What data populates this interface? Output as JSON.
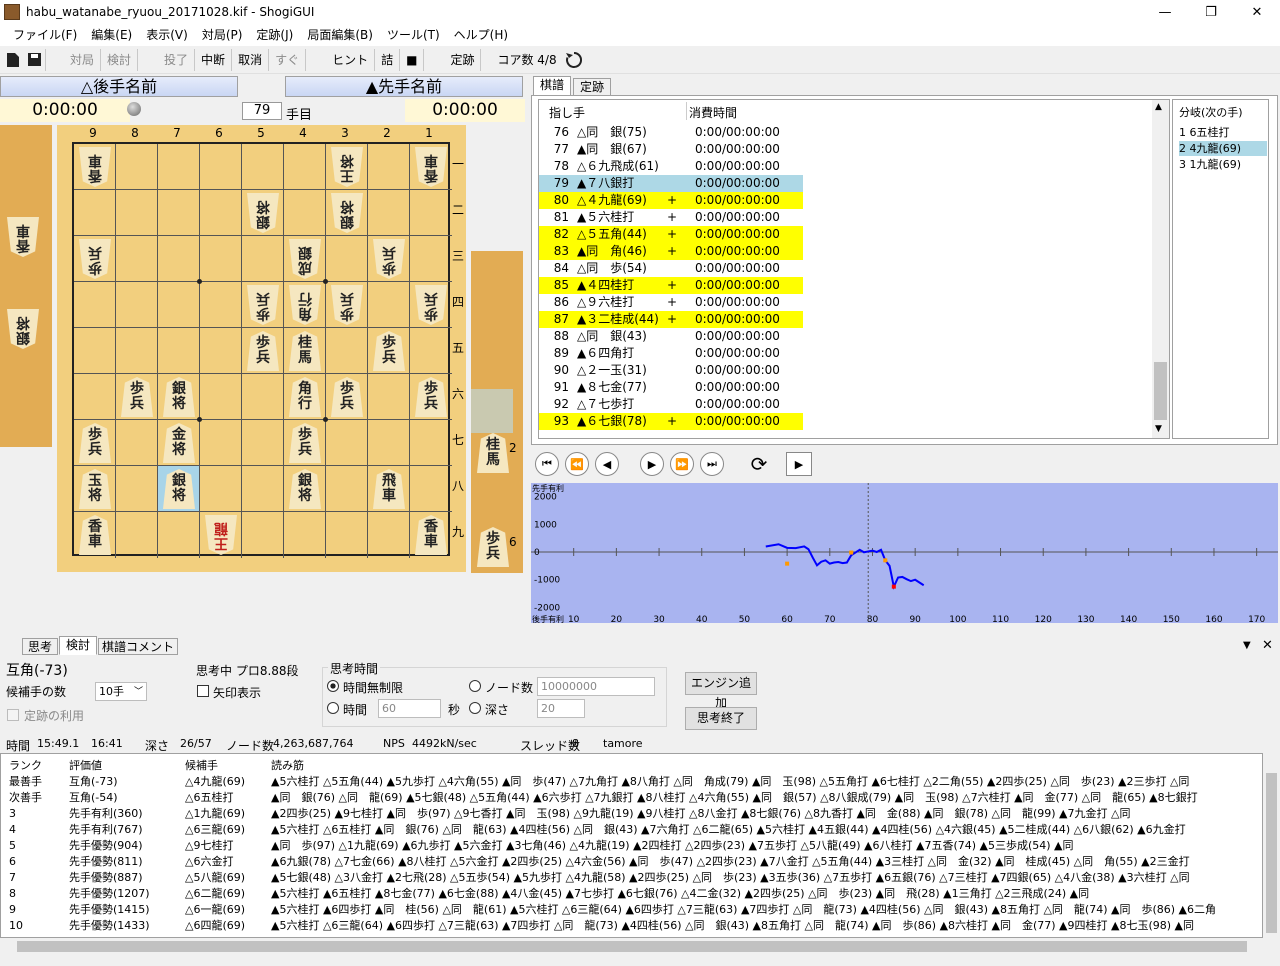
{
  "window": {
    "title": "habu_watanabe_ryuou_20171028.kif - ShogiGUI",
    "min": "—",
    "max": "❐",
    "close": "✕"
  },
  "menu": [
    "ファイル(F)",
    "編集(E)",
    "表示(V)",
    "対局(P)",
    "定跡(J)",
    "局面編集(B)",
    "ツール(T)",
    "ヘルプ(H)"
  ],
  "toolbar": {
    "items": [
      "対局",
      "検討",
      "投了",
      "中断",
      "取消",
      "すぐ",
      "ヒント",
      "詰",
      "■",
      "定跡",
      "コア数  4/8"
    ],
    "disabled": [
      true,
      true,
      true,
      false,
      false,
      true,
      false,
      false,
      false,
      false,
      false
    ]
  },
  "players": {
    "gote": "△後手名前",
    "sente": "▲先手名前"
  },
  "clocks": {
    "gote": "0:00:00",
    "sente": "0:00:00"
  },
  "move_counter": {
    "value": "79",
    "suffix": "手目"
  },
  "board": {
    "col_labels": [
      "9",
      "8",
      "7",
      "6",
      "5",
      "4",
      "3",
      "2",
      "1"
    ],
    "row_labels": [
      "一",
      "二",
      "三",
      "四",
      "五",
      "六",
      "七",
      "八",
      "九"
    ],
    "pieces": [
      {
        "r": 0,
        "c": 0,
        "t": "香\n車",
        "gote": true
      },
      {
        "r": 0,
        "c": 6,
        "t": "王\n将",
        "gote": true
      },
      {
        "r": 0,
        "c": 8,
        "t": "香\n車",
        "gote": true
      },
      {
        "r": 1,
        "c": 4,
        "t": "銀\n将",
        "gote": true
      },
      {
        "r": 1,
        "c": 6,
        "t": "銀\n将",
        "gote": true
      },
      {
        "r": 2,
        "c": 0,
        "t": "歩\n兵",
        "gote": true
      },
      {
        "r": 2,
        "c": 5,
        "t": "成\n銀",
        "gote": true
      },
      {
        "r": 2,
        "c": 7,
        "t": "歩\n兵",
        "gote": true
      },
      {
        "r": 3,
        "c": 4,
        "t": "歩\n兵",
        "gote": true
      },
      {
        "r": 3,
        "c": 5,
        "t": "角\n行",
        "gote": true
      },
      {
        "r": 3,
        "c": 6,
        "t": "歩\n兵",
        "gote": true
      },
      {
        "r": 3,
        "c": 8,
        "t": "歩\n兵",
        "gote": true
      },
      {
        "r": 4,
        "c": 4,
        "t": "歩\n兵",
        "gote": false
      },
      {
        "r": 4,
        "c": 5,
        "t": "桂\n馬",
        "gote": false
      },
      {
        "r": 4,
        "c": 7,
        "t": "歩\n兵",
        "gote": false
      },
      {
        "r": 5,
        "c": 1,
        "t": "歩\n兵",
        "gote": false
      },
      {
        "r": 5,
        "c": 2,
        "t": "銀\n将",
        "gote": false
      },
      {
        "r": 5,
        "c": 5,
        "t": "角\n行",
        "gote": false
      },
      {
        "r": 5,
        "c": 6,
        "t": "歩\n兵",
        "gote": false
      },
      {
        "r": 5,
        "c": 8,
        "t": "歩\n兵",
        "gote": false
      },
      {
        "r": 6,
        "c": 0,
        "t": "歩\n兵",
        "gote": false
      },
      {
        "r": 6,
        "c": 2,
        "t": "金\n将",
        "gote": false
      },
      {
        "r": 6,
        "c": 5,
        "t": "歩\n兵",
        "gote": false
      },
      {
        "r": 7,
        "c": 0,
        "t": "玉\n将",
        "gote": false
      },
      {
        "r": 7,
        "c": 2,
        "t": "銀\n将",
        "gote": false
      },
      {
        "r": 7,
        "c": 5,
        "t": "銀\n将",
        "gote": false
      },
      {
        "r": 7,
        "c": 7,
        "t": "飛\n車",
        "gote": false
      },
      {
        "r": 8,
        "c": 0,
        "t": "香\n車",
        "gote": false
      },
      {
        "r": 8,
        "c": 3,
        "t": "王\n龍",
        "gote": true,
        "red": true
      },
      {
        "r": 8,
        "c": 8,
        "t": "香\n車",
        "gote": false
      }
    ],
    "highlight": {
      "r": 7,
      "c": 2
    }
  },
  "gote_hand": [
    {
      "t": "香\n車"
    },
    {
      "t": "銀\n将"
    }
  ],
  "sente_hand": [
    {
      "t": "桂\n馬",
      "n": "2"
    },
    {
      "t": "歩\n兵",
      "n": "6"
    }
  ],
  "tabs_right": [
    "棋譜",
    "定跡"
  ],
  "kifu": {
    "headers": [
      "指し手",
      "消費時間"
    ],
    "rows": [
      {
        "n": "76",
        "m": "△同　銀(75)",
        "p": "",
        "t": "0:00/00:00:00",
        "hl": ""
      },
      {
        "n": "77",
        "m": "▲同　銀(67)",
        "p": "",
        "t": "0:00/00:00:00",
        "hl": ""
      },
      {
        "n": "78",
        "m": "△６九飛成(61)",
        "p": "",
        "t": "0:00/00:00:00",
        "hl": ""
      },
      {
        "n": "79",
        "m": "▲７八銀打",
        "p": "",
        "t": "0:00/00:00:00",
        "hl": "blue"
      },
      {
        "n": "80",
        "m": "△４九龍(69)",
        "p": "+",
        "t": "0:00/00:00:00",
        "hl": "yellow"
      },
      {
        "n": "81",
        "m": "▲５六桂打",
        "p": "+",
        "t": "0:00/00:00:00",
        "hl": ""
      },
      {
        "n": "82",
        "m": "△５五角(44)",
        "p": "+",
        "t": "0:00/00:00:00",
        "hl": "yellow"
      },
      {
        "n": "83",
        "m": "▲同　角(46)",
        "p": "+",
        "t": "0:00/00:00:00",
        "hl": "yellow"
      },
      {
        "n": "84",
        "m": "△同　歩(54)",
        "p": "",
        "t": "0:00/00:00:00",
        "hl": ""
      },
      {
        "n": "85",
        "m": "▲４四桂打",
        "p": "+",
        "t": "0:00/00:00:00",
        "hl": "yellow"
      },
      {
        "n": "86",
        "m": "△９六桂打",
        "p": "+",
        "t": "0:00/00:00:00",
        "hl": ""
      },
      {
        "n": "87",
        "m": "▲３二桂成(44)",
        "p": "+",
        "t": "0:00/00:00:00",
        "hl": "yellow"
      },
      {
        "n": "88",
        "m": "△同　銀(43)",
        "p": "",
        "t": "0:00/00:00:00",
        "hl": ""
      },
      {
        "n": "89",
        "m": "▲６四角打",
        "p": "",
        "t": "0:00/00:00:00",
        "hl": ""
      },
      {
        "n": "90",
        "m": "△２一玉(31)",
        "p": "",
        "t": "0:00/00:00:00",
        "hl": ""
      },
      {
        "n": "91",
        "m": "▲８七金(77)",
        "p": "",
        "t": "0:00/00:00:00",
        "hl": ""
      },
      {
        "n": "92",
        "m": "△７七歩打",
        "p": "",
        "t": "0:00/00:00:00",
        "hl": ""
      },
      {
        "n": "93",
        "m": "▲６七銀(78)",
        "p": "+",
        "t": "0:00/00:00:00",
        "hl": "yellow"
      }
    ]
  },
  "branches": {
    "header": "分岐(次の手)",
    "items": [
      "1 6五桂打",
      "2 4九龍(69)",
      "3 1九龍(69)"
    ],
    "selected": 1
  },
  "nav_icons": [
    "first-move-icon",
    "prev-branch-icon",
    "prev-move-icon",
    "next-move-icon",
    "next-branch-icon",
    "last-move-icon",
    "flip-board-icon",
    "play-icon"
  ],
  "graph": {
    "ylabel_top": "先手有利",
    "ylabel_bottom": "後手有利",
    "yticks": [
      "2000",
      "1000",
      "0",
      "-1000",
      "-2000"
    ],
    "xticks": [
      "10",
      "20",
      "30",
      "40",
      "50",
      "60",
      "70",
      "80",
      "90",
      "100",
      "110",
      "120",
      "130",
      "140",
      "150",
      "160",
      "170"
    ],
    "xlim": [
      0,
      175
    ],
    "ylim": [
      -2200,
      2200
    ],
    "cursor_x": 79,
    "points": [
      [
        55,
        200
      ],
      [
        58,
        280
      ],
      [
        60,
        150
      ],
      [
        62,
        140
      ],
      [
        64,
        200
      ],
      [
        65,
        100
      ],
      [
        66,
        -200
      ],
      [
        67,
        -480
      ],
      [
        68,
        -350
      ],
      [
        69,
        -300
      ],
      [
        70,
        -420
      ],
      [
        71,
        -380
      ],
      [
        72,
        -360
      ],
      [
        73,
        -400
      ],
      [
        74,
        -380
      ],
      [
        75,
        -120
      ],
      [
        76,
        -20
      ],
      [
        77,
        80
      ],
      [
        78,
        -10
      ],
      [
        79,
        20
      ],
      [
        80,
        50
      ],
      [
        81,
        0
      ],
      [
        82,
        80
      ],
      [
        83,
        -300
      ],
      [
        84,
        -500
      ],
      [
        85,
        -1250
      ],
      [
        86,
        -920
      ],
      [
        87,
        -900
      ],
      [
        88,
        -980
      ],
      [
        89,
        -1050
      ],
      [
        90,
        -1000
      ],
      [
        91,
        -1100
      ],
      [
        92,
        -1200
      ]
    ],
    "markers": [
      [
        60,
        -420
      ],
      [
        75,
        -20
      ],
      [
        83,
        -300
      ],
      [
        85,
        -1250
      ]
    ]
  },
  "tabs_bottom": [
    "思考",
    "検討",
    "棋譜コメント"
  ],
  "analysis": {
    "eval": "互角(-73)",
    "status": "思考中 プロ8.88段",
    "candidates_label": "候補手の数",
    "candidates_value": "10手",
    "arrow_label": "矢印表示",
    "book_label": "定跡の利用",
    "time_group": "思考時間",
    "unlimited": "時間無制限",
    "nodes_label": "ノード数",
    "nodes_value": "10000000",
    "time_label": "時間",
    "time_value": "60",
    "sec_label": "秒",
    "depth_label": "深さ",
    "depth_value": "20",
    "add_engine": "エンジン追加",
    "stop": "思考終了"
  },
  "statusline": {
    "time_label": "時間",
    "time1": "15:49.1",
    "time2": "16:41",
    "depth_label": "深さ",
    "depth": "26/57",
    "nodes_label": "ノード数",
    "nodes": "4,263,687,764",
    "nps_label": "NPS",
    "nps": "4492kN/sec",
    "threads_label": "スレッド数",
    "threads": "8",
    "engine": "tamore"
  },
  "pv": {
    "headers": [
      "ランク",
      "評価値",
      "候補手",
      "読み筋"
    ],
    "rows": [
      [
        "最善手",
        "互角(-73)",
        "△4九龍(69)",
        "▲5六桂打 △5五角(44) ▲5九歩打 △4六角(55) ▲同　歩(47) △7九角打 ▲8八角打 △同　角成(79) ▲同　玉(98) △5五角打 ▲6七桂打 △2二角(55) ▲2四歩(25) △同　歩(23) ▲2三歩打 △同"
      ],
      [
        "次善手",
        "互角(-54)",
        "△6五桂打",
        "▲同　銀(76) △同　龍(69) ▲5七銀(48) △5五角(44) ▲6六歩打 △7九銀打 ▲8八桂打 △4六角(55) ▲同　銀(57) △8八銀成(79) ▲同　玉(98) △7六桂打 ▲同　金(77) △同　龍(65) ▲8七銀打"
      ],
      [
        "3",
        "先手有利(360)",
        "△1九龍(69)",
        "▲2四歩(25) ▲9七桂打 ▲同　歩(97) △9七香打 ▲同　玉(98) △9九龍(19) ▲9八桂打 △8八金打 ▲8七銀(76) △8九香打 ▲同　金(88) ▲同　銀(78) △同　龍(99) ▲7九金打 △同"
      ],
      [
        "4",
        "先手有利(767)",
        "△6三龍(69)",
        "▲5六桂打 △6五桂打 ▲同　銀(76) △同　龍(63) ▲4四桂(56) △同　銀(43) ▲7六角打 △6二龍(65) ▲5六桂打 ▲4五銀(44) ▲4四桂(56) △4六銀(45) ▲5二桂成(44) △6八銀(62) ▲6九金打"
      ],
      [
        "5",
        "先手優勢(904)",
        "△9七桂打",
        "▲同　歩(97) △1九龍(69) ▲6九歩打 ▲5六金打 ▲3七角(46) △4九龍(19) ▲2四桂打 △2四歩(23) ▲7五歩打 △5八龍(49) ▲6八桂打 ▲7五香(74) ▲5三歩成(54) ▲同"
      ],
      [
        "6",
        "先手優勢(811)",
        "△6六金打",
        "▲6九銀(78) △7七金(66) ▲8八桂打 △5六金打 ▲2四歩(25) △4六金(56) ▲同　歩(47) △2四歩(23) ▲7八金打 △5五角(44) ▲3三桂打 △同　金(32) ▲同　桂成(45) △同　角(55) ▲2三金打"
      ],
      [
        "7",
        "先手優勢(887)",
        "△5八龍(69)",
        "▲5七銀(48) △3八金打 ▲2七飛(28) △5五歩(54) ▲5九歩打 △4九龍(58) ▲2四歩(25) △同　歩(23) ▲3五歩(36) △7五歩打 ▲6五銀(76) △7三桂打 ▲7四銀(65) △4八金(38) ▲3六桂打 △同"
      ],
      [
        "8",
        "先手優勢(1207)",
        "△6二龍(69)",
        "▲5六桂打 ▲6五桂打 ▲8七金(77) ▲6七金(88) ▲4八金(45) ▲7七歩打 ▲6七銀(76) △4二金(32) ▲2四歩(25) △同　歩(23) ▲同　飛(28) ▲1三角打 △2三飛成(24) ▲同"
      ],
      [
        "9",
        "先手優勢(1415)",
        "△6一龍(69)",
        "▲5六桂打 ▲6四歩打 ▲同　桂(56) △同　龍(61) ▲5六桂打 △6三龍(64) ▲6四歩打 △7三龍(63) ▲7四歩打 △同　龍(73) ▲4四桂(56) △同　銀(43) ▲8五角打 △同　龍(74) ▲同　歩(86) ▲6二角"
      ],
      [
        "10",
        "先手優勢(1433)",
        "△6四龍(69)",
        "▲5六桂打 △6三龍(64) ▲6四歩打 △7三龍(63) ▲7四歩打 △同　龍(73) ▲4四桂(56) △同　銀(43) ▲8五角打 △同　龍(74) ▲同　歩(86) ▲8六桂打 ▲同　金(77) ▲9四桂打 ▲8七玉(98) ▲同"
      ]
    ]
  },
  "colors": {
    "yellow": "#ffff00",
    "selected": "#add8e6",
    "graph_bg": "#a9b4f0",
    "line": "#0000ff"
  }
}
